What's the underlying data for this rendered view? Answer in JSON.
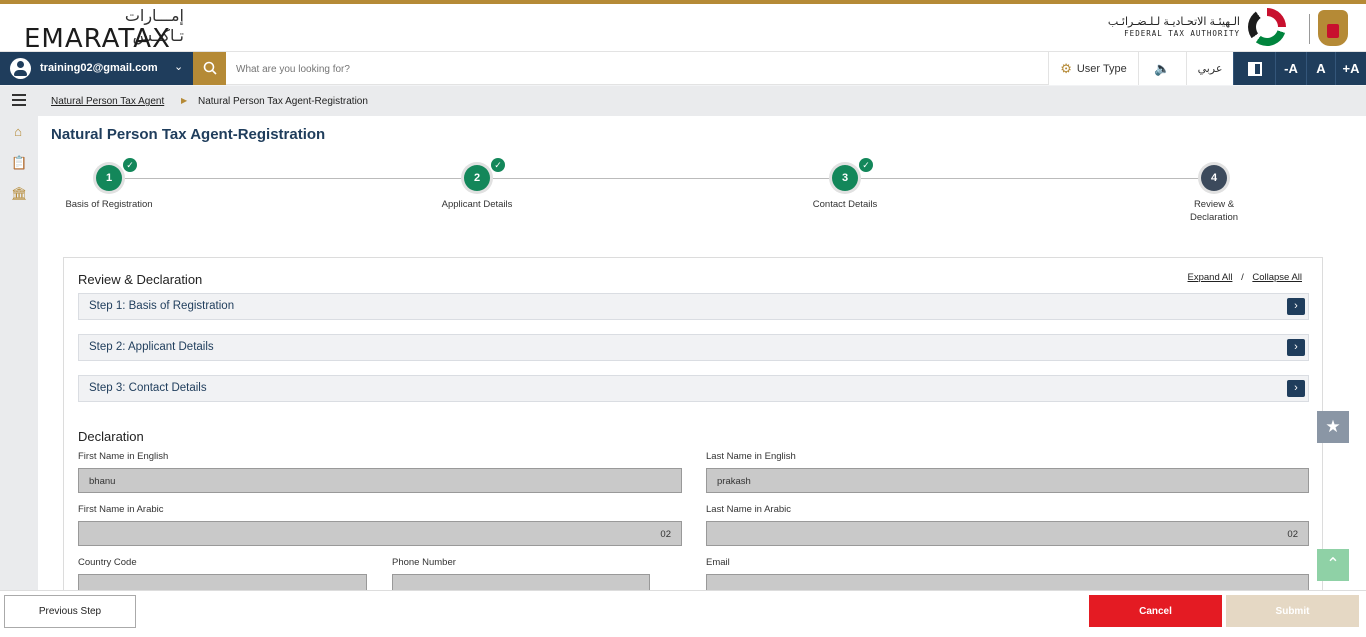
{
  "header": {
    "logo_ar": "إمـــارات تـاكــس",
    "logo_en": "EMARATAX",
    "fta_ar": "الـهيئـة الاتحـاديـة لـلـضـرائـب",
    "fta_en": "FEDERAL TAX AUTHORITY"
  },
  "toolbar": {
    "user_email": "training02@gmail.com",
    "search_placeholder": "What are you looking for?",
    "user_type_label": "User Type",
    "language_label": "عربي",
    "font_decrease": "-A",
    "font_normal": "A",
    "font_increase": "+A"
  },
  "breadcrumb": {
    "parent": "Natural Person Tax Agent",
    "current": "Natural Person Tax Agent-Registration"
  },
  "page": {
    "title": "Natural Person Tax Agent-Registration"
  },
  "steps": [
    {
      "number": "1",
      "label": "Basis of Registration",
      "completed": true
    },
    {
      "number": "2",
      "label": "Applicant Details",
      "completed": true
    },
    {
      "number": "3",
      "label": "Contact Details",
      "completed": true
    },
    {
      "number": "4",
      "label": "Review &\nDeclaration",
      "completed": false
    }
  ],
  "review": {
    "title": "Review & Declaration",
    "expand_all": "Expand All",
    "separator": "/",
    "collapse_all": "Collapse All",
    "sections": [
      {
        "label": "Step 1: Basis of Registration"
      },
      {
        "label": "Step 2: Applicant Details"
      },
      {
        "label": "Step 3: Contact Details"
      }
    ]
  },
  "declaration": {
    "title": "Declaration",
    "first_name_en_label": "First Name in English",
    "first_name_en_value": "bhanu",
    "last_name_en_label": "Last Name in English",
    "last_name_en_value": "prakash",
    "first_name_ar_label": "First Name in Arabic",
    "first_name_ar_value": "02",
    "last_name_ar_label": "Last Name in Arabic",
    "last_name_ar_value": "02",
    "country_code_label": "Country Code",
    "phone_label": "Phone Number",
    "email_label": "Email"
  },
  "footer": {
    "previous_label": "Previous Step",
    "cancel_label": "Cancel",
    "submit_label": "Submit"
  },
  "colors": {
    "brand_navy": "#1f3d5c",
    "brand_gold": "#b58a36",
    "success_green": "#13875a",
    "cancel_red": "#e41b23"
  }
}
